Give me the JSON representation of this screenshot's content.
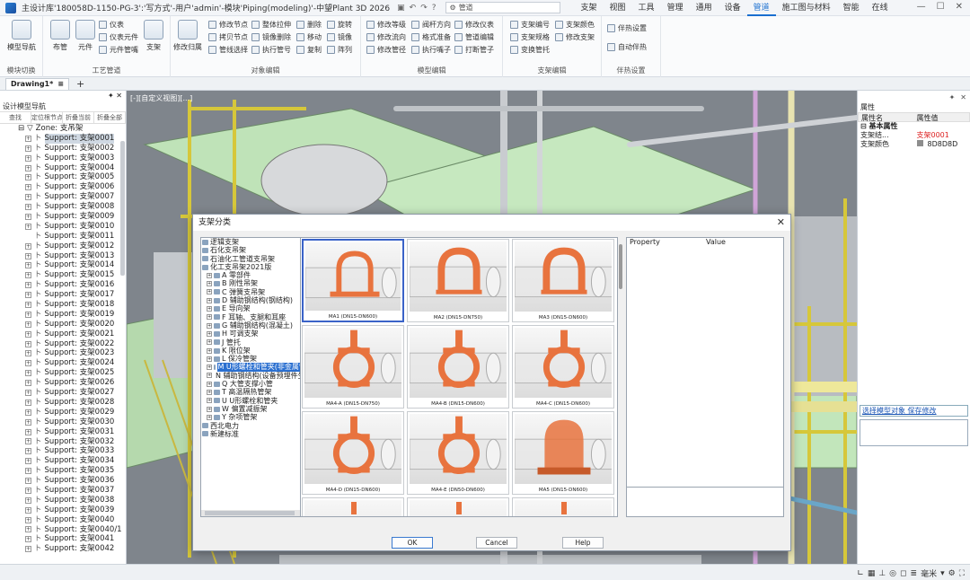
{
  "title": "主设计库'180058D-1150-PG-3':'写方式'-用户'admin'-模块'Piping(modeling)'-中望Plant 3D 2026",
  "search_placeholder": "管道",
  "menu": [
    "支架",
    "视图",
    "工具",
    "管理",
    "通用",
    "设备",
    "管道",
    "施工图与材料",
    "智能",
    "在线"
  ],
  "active_menu": "管道",
  "ribbon": {
    "groups": [
      {
        "label": "模块切换",
        "big": [
          "模型导航"
        ]
      },
      {
        "label": "工艺管道",
        "big": [
          "布管",
          "元件",
          "支架"
        ],
        "small": [
          "仪表",
          "仪表元件",
          "元件管嘴"
        ]
      },
      {
        "label": "对象编辑",
        "big": [
          "修改归属"
        ],
        "small": [
          "修改节点",
          "拷贝节点",
          "管线选择",
          "整体拉伸",
          "镜像删除",
          "执行管号",
          "删除",
          "移动",
          "复制",
          "旋转",
          "镜像",
          "阵列"
        ]
      },
      {
        "label": "模型编辑",
        "small": [
          "修改等级",
          "修改流向",
          "修改管径",
          "阀杆方向",
          "格式准备",
          "执行嘴子",
          "修改仪表",
          "管道编辑",
          "打断管子"
        ]
      },
      {
        "label": "支架编辑",
        "small": [
          "支架编号",
          "支架规格",
          "变换管托",
          "支架颜色",
          "修改支架"
        ]
      },
      {
        "label": "伴热设置",
        "small": [
          "伴热设置",
          "自动伴热"
        ]
      }
    ]
  },
  "doc_tab": "Drawing1*",
  "left_panel": {
    "header": "设计模型导航",
    "tools": [
      "查找",
      "定位根节点",
      "折叠当前",
      "折叠全部"
    ],
    "zone": "Zone: 支吊架",
    "items": [
      "Support: 支架0001",
      "Support: 支架0002",
      "Support: 支架0003",
      "Support: 支架0004",
      "Support: 支架0005",
      "Support: 支架0006",
      "Support: 支架0007",
      "Support: 支架0008",
      "Support: 支架0009",
      "Support: 支架0010",
      "Support: 支架0011",
      "Support: 支架0012",
      "Support: 支架0013",
      "Support: 支架0014",
      "Support: 支架0015",
      "Support: 支架0016",
      "Support: 支架0017",
      "Support: 支架0018",
      "Support: 支架0019",
      "Support: 支架0020",
      "Support: 支架0021",
      "Support: 支架0022",
      "Support: 支架0023",
      "Support: 支架0024",
      "Support: 支架0025",
      "Support: 支架0026",
      "Support: 支架0027",
      "Support: 支架0028",
      "Support: 支架0029",
      "Support: 支架0030",
      "Support: 支架0031",
      "Support: 支架0032",
      "Support: 支架0033",
      "Support: 支架0034",
      "Support: 支架0035",
      "Support: 支架0036",
      "Support: 支架0037",
      "Support: 支架0038",
      "Support: 支架0039",
      "Support: 支架0040",
      "Support: 支架0040/1",
      "Support: 支架0041",
      "Support: 支架0042"
    ]
  },
  "viewport_label": "[-][自定义视图][...]",
  "right_panel": {
    "tab": "属性",
    "col_name": "属性名",
    "col_value": "属性值",
    "category": "基本属性",
    "rows": [
      {
        "name": "支架结...",
        "value": "支架0001"
      },
      {
        "name": "支架颜色",
        "value": "8D8D8D"
      }
    ],
    "links": "选择模型对象 保存修改"
  },
  "dialog": {
    "title": "支架分类",
    "tree": [
      "逻辑支架",
      "石化支吊架",
      "石油化工管道支吊架",
      "化工支吊架2021版",
      "A 零部件",
      "B 刚性吊架",
      "C 弹簧支吊架",
      "D 辅助钢结构(钢结构)",
      "E 导向架",
      "F 耳轴、支腿和耳座",
      "G 辅助钢结构(混凝土)",
      "H 可调支架",
      "J 管托",
      "K 限位架",
      "L 保冷管架",
      "M U形螺栓和管夹(非金属管)",
      "N 辅助钢结构(设备预埋件生根)",
      "Q 大管支撑小管",
      "T 高温隔热管架",
      "U U形螺栓和管夹",
      "W 偏置减振架",
      "Y 杂项管架",
      "西北电力",
      "新建标准"
    ],
    "selected_tree": "M U形螺栓和管夹(非金属管)",
    "thumbs": [
      "MA1 (DN15-DN600)",
      "MA2 (DN15-DN750)",
      "MA3 (DN15-DN600)",
      "MA4-A (DN15-DN750)",
      "MA4-B (DN15-DN600)",
      "MA4-C (DN15-DN600)",
      "MA4-D (DN15-DN600)",
      "MA4-E (DN50-DN600)",
      "MA5 (DN15-DN600)"
    ],
    "prop_col": "Property",
    "value_col": "Value",
    "ok": "OK",
    "cancel": "Cancel",
    "help": "Help"
  },
  "status": {
    "unit": "毫米"
  },
  "colors": {
    "accent": "#1a6fd0",
    "clamp": "#e8733e",
    "selection": "#2a6fd0"
  }
}
